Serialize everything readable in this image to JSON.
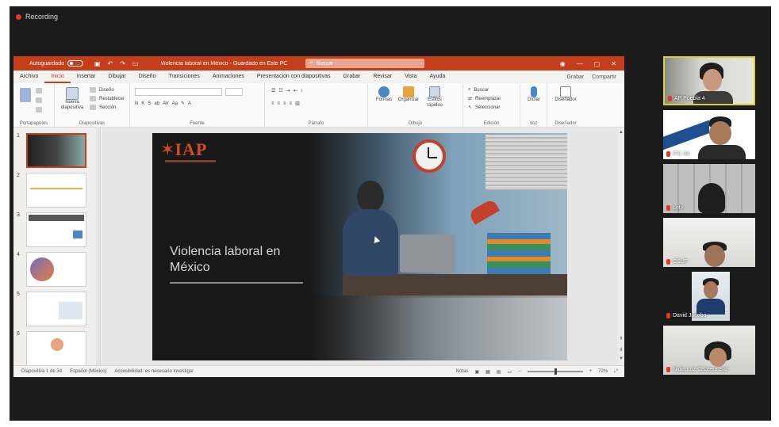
{
  "recording": {
    "label": "Recording"
  },
  "titlebar": {
    "autosave": "Autoguardado",
    "document": "Violencia laboral en México - Guardado en Este PC",
    "search_placeholder": "Buscar"
  },
  "tabs": [
    "Archivo",
    "Inicio",
    "Insertar",
    "Dibujar",
    "Diseño",
    "Transiciones",
    "Animaciones",
    "Presentación con diapositivas",
    "Grabar",
    "Revisar",
    "Vista",
    "Ayuda"
  ],
  "tabs_active": "Inicio",
  "tabs_right": {
    "record": "Grabar",
    "share": "Compartir"
  },
  "ribbon": {
    "groups": [
      "Portapapeles",
      "Diapositivas",
      "Fuente",
      "Párrafo",
      "Dibujo",
      "Edición",
      "Voz",
      "Diseñador"
    ],
    "new_slide": "Nueva diapositiva",
    "slide_opts": [
      "Diseño",
      "Restablecer",
      "Sección"
    ],
    "shapes": "Formas",
    "arrange": "Organizar",
    "quick_styles": "Estilos rápidos",
    "editing": [
      "Buscar",
      "Reemplazar",
      "Seleccionar"
    ],
    "dictate": "Dictar",
    "designer": "Diseñador"
  },
  "thumbnails": [
    "1",
    "2",
    "3",
    "4",
    "5",
    "6"
  ],
  "slide": {
    "logo": "IAP",
    "title": "Violencia laboral en México"
  },
  "status": {
    "slide_count": "Diapositiva 1 de 34",
    "language": "Español (México)",
    "accessibility": "Accesibilidad: es necesario investigar",
    "notes": "Notas",
    "zoom": "72%"
  },
  "participants": [
    {
      "name": "AP Puebla 4",
      "active": true
    },
    {
      "name": "ITC 04",
      "active": false
    },
    {
      "name": "Lety",
      "active": false
    },
    {
      "name": "CSUF",
      "active": false
    },
    {
      "name": "David Jocobo",
      "active": false
    },
    {
      "name": "Nidia Luz Cabrera Sali",
      "active": false
    }
  ],
  "colors": {
    "accent": "#c43e1c",
    "active_speaker": "#d8d32a",
    "mic_off": "#e0392b"
  }
}
